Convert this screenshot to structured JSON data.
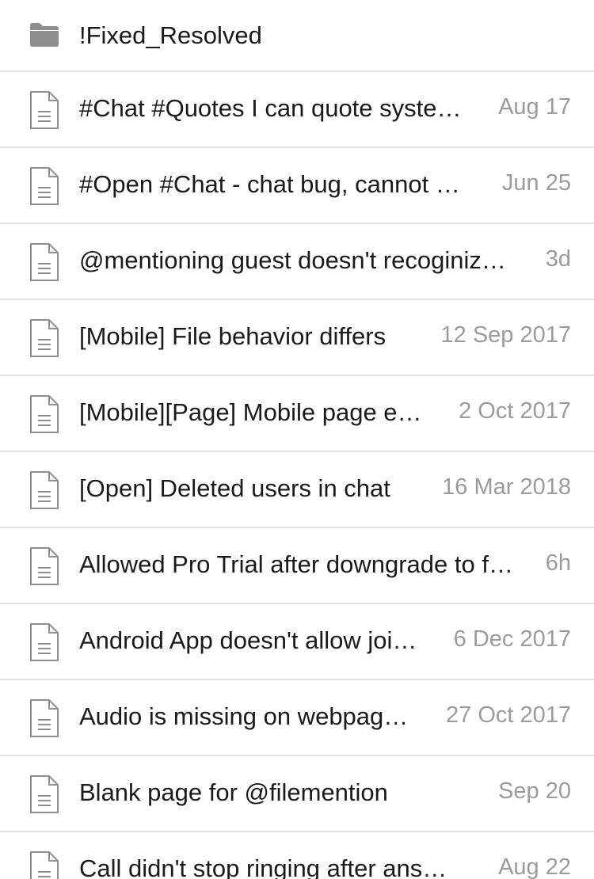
{
  "folder": {
    "name": "!Fixed_Resolved",
    "icon": "folder-icon"
  },
  "files": [
    {
      "title": "#Chat #Quotes I can quote system message",
      "date": "Aug 17",
      "icon": "document-icon"
    },
    {
      "title": "#Open #Chat - chat bug, cannot send message",
      "date": "Jun 25",
      "icon": "document-icon"
    },
    {
      "title": "@mentioning guest doesn't recoginize guest",
      "date": "3d",
      "icon": "document-icon"
    },
    {
      "title": "[Mobile] File behavior differs",
      "date": "12 Sep 2017",
      "icon": "document-icon"
    },
    {
      "title": "[Mobile][Page] Mobile page editing",
      "date": "2 Oct 2017",
      "icon": "document-icon"
    },
    {
      "title": "[Open] Deleted users in chat",
      "date": "16 Mar 2018",
      "icon": "document-icon"
    },
    {
      "title": "Allowed Pro Trial after downgrade to free",
      "date": "6h",
      "icon": "document-icon"
    },
    {
      "title": "Android App doesn't allow joining",
      "date": "6 Dec 2017",
      "icon": "document-icon"
    },
    {
      "title": "Audio is missing on webpage player",
      "date": "27 Oct 2017",
      "icon": "document-icon"
    },
    {
      "title": "Blank page for @filemention",
      "date": "Sep 20",
      "icon": "document-icon"
    },
    {
      "title": "Call didn't stop ringing after answering",
      "date": "Aug 22",
      "icon": "document-icon"
    }
  ],
  "colors": {
    "title_text": "#1a1a1a",
    "date_text": "#9b9b9b",
    "divider": "#e5e5e5",
    "folder_icon": "#8e8e8e",
    "document_icon_stroke": "#8e8e8e"
  }
}
